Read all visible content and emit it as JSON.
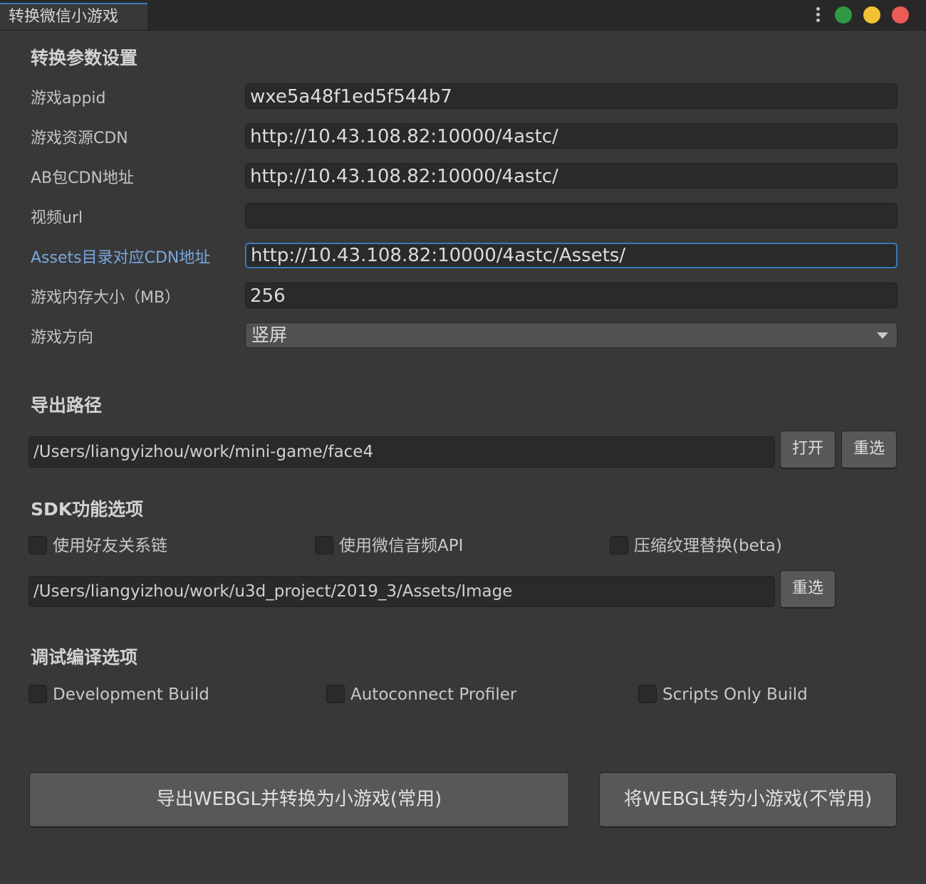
{
  "window": {
    "tab_title": "转换微信小游戏",
    "menu_icon": "vertical-ellipsis",
    "traffic_lights": [
      "#2f9a43",
      "#f3c233",
      "#ec5b57"
    ]
  },
  "params": {
    "section_title": "转换参数设置",
    "fields": [
      {
        "label": "游戏appid",
        "value": "wxe5a48f1ed5f544b7"
      },
      {
        "label": "游戏资源CDN",
        "value": "http://10.43.108.82:10000/4astc/"
      },
      {
        "label": "AB包CDN地址",
        "value": "http://10.43.108.82:10000/4astc/"
      },
      {
        "label": "视频url",
        "value": ""
      },
      {
        "label": "Assets目录对应CDN地址",
        "value": "http://10.43.108.82:10000/4astc/Assets/"
      },
      {
        "label": "游戏内存大小（MB）",
        "value": "256"
      }
    ],
    "orientation": {
      "label": "游戏方向",
      "value": "竖屏"
    }
  },
  "export": {
    "section_title": "导出路径",
    "path": "/Users/liangyizhou/work/mini-game/face4",
    "open_label": "打开",
    "reselect_label": "重选"
  },
  "sdk": {
    "section_title": "SDK功能选项",
    "options": [
      {
        "label": "使用好友关系链",
        "checked": false
      },
      {
        "label": "使用微信音频API",
        "checked": false
      },
      {
        "label": "压缩纹理替换(beta)",
        "checked": false
      }
    ],
    "path": "/Users/liangyizhou/work/u3d_project/2019_3/Assets/Image",
    "reselect_label": "重选"
  },
  "debug": {
    "section_title": "调试编译选项",
    "options": [
      {
        "label": "Development Build",
        "checked": false
      },
      {
        "label": "Autoconnect Profiler",
        "checked": false
      },
      {
        "label": "Scripts Only Build",
        "checked": false
      }
    ]
  },
  "actions": {
    "export_convert_label": "导出WEBGL并转换为小游戏(常用)",
    "convert_label": "将WEBGL转为小游戏(不常用)"
  },
  "colors": {
    "background": "#383838",
    "focus_accent": "#3a79bb",
    "focused_label": "#79a7e0"
  }
}
